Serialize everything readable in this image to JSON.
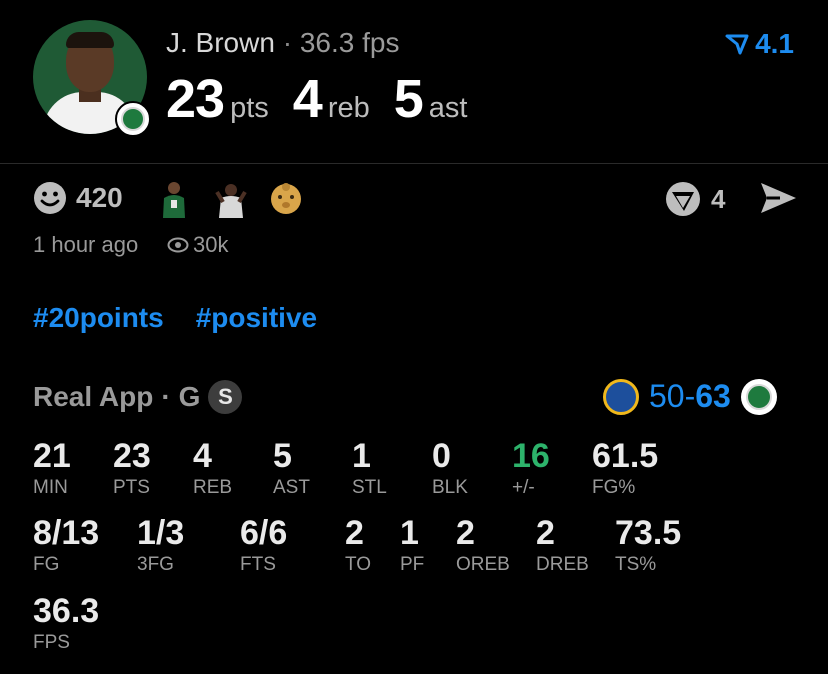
{
  "player": {
    "name": "J. Brown",
    "separator": "·",
    "fps": "36.3 fps",
    "rating": "4.1",
    "points": "23",
    "points_unit": "pts",
    "rebounds": "4",
    "rebounds_unit": "reb",
    "assists": "5",
    "assists_unit": "ast"
  },
  "reactions": {
    "count": "420",
    "reel_count": "4"
  },
  "meta": {
    "time": "1 hour ago",
    "views": "30k"
  },
  "tags": [
    "#20points",
    "#positive"
  ],
  "game": {
    "source": "Real App",
    "dot": "·",
    "position": "G",
    "badge": "S",
    "score_away": "50",
    "score_dash": "-",
    "score_home": "63",
    "colors": {
      "accent": "#1d8cf0",
      "positive": "#2db36b"
    }
  },
  "stats": [
    {
      "value": "21",
      "label": "MIN"
    },
    {
      "value": "23",
      "label": "PTS"
    },
    {
      "value": "4",
      "label": "REB"
    },
    {
      "value": "5",
      "label": "AST"
    },
    {
      "value": "1",
      "label": "STL"
    },
    {
      "value": "0",
      "label": "BLK"
    },
    {
      "value": "16",
      "label": "+/-"
    },
    {
      "value": "61.5",
      "label": "FG%"
    },
    {
      "value": "8/13",
      "label": "FG"
    },
    {
      "value": "1/3",
      "label": "3FG"
    },
    {
      "value": "6/6",
      "label": "FTS"
    },
    {
      "value": "2",
      "label": "TO"
    },
    {
      "value": "1",
      "label": "PF"
    },
    {
      "value": "2",
      "label": "OREB"
    },
    {
      "value": "2",
      "label": "DREB"
    },
    {
      "value": "73.5",
      "label": "TS%"
    },
    {
      "value": "36.3",
      "label": "FPS"
    }
  ]
}
